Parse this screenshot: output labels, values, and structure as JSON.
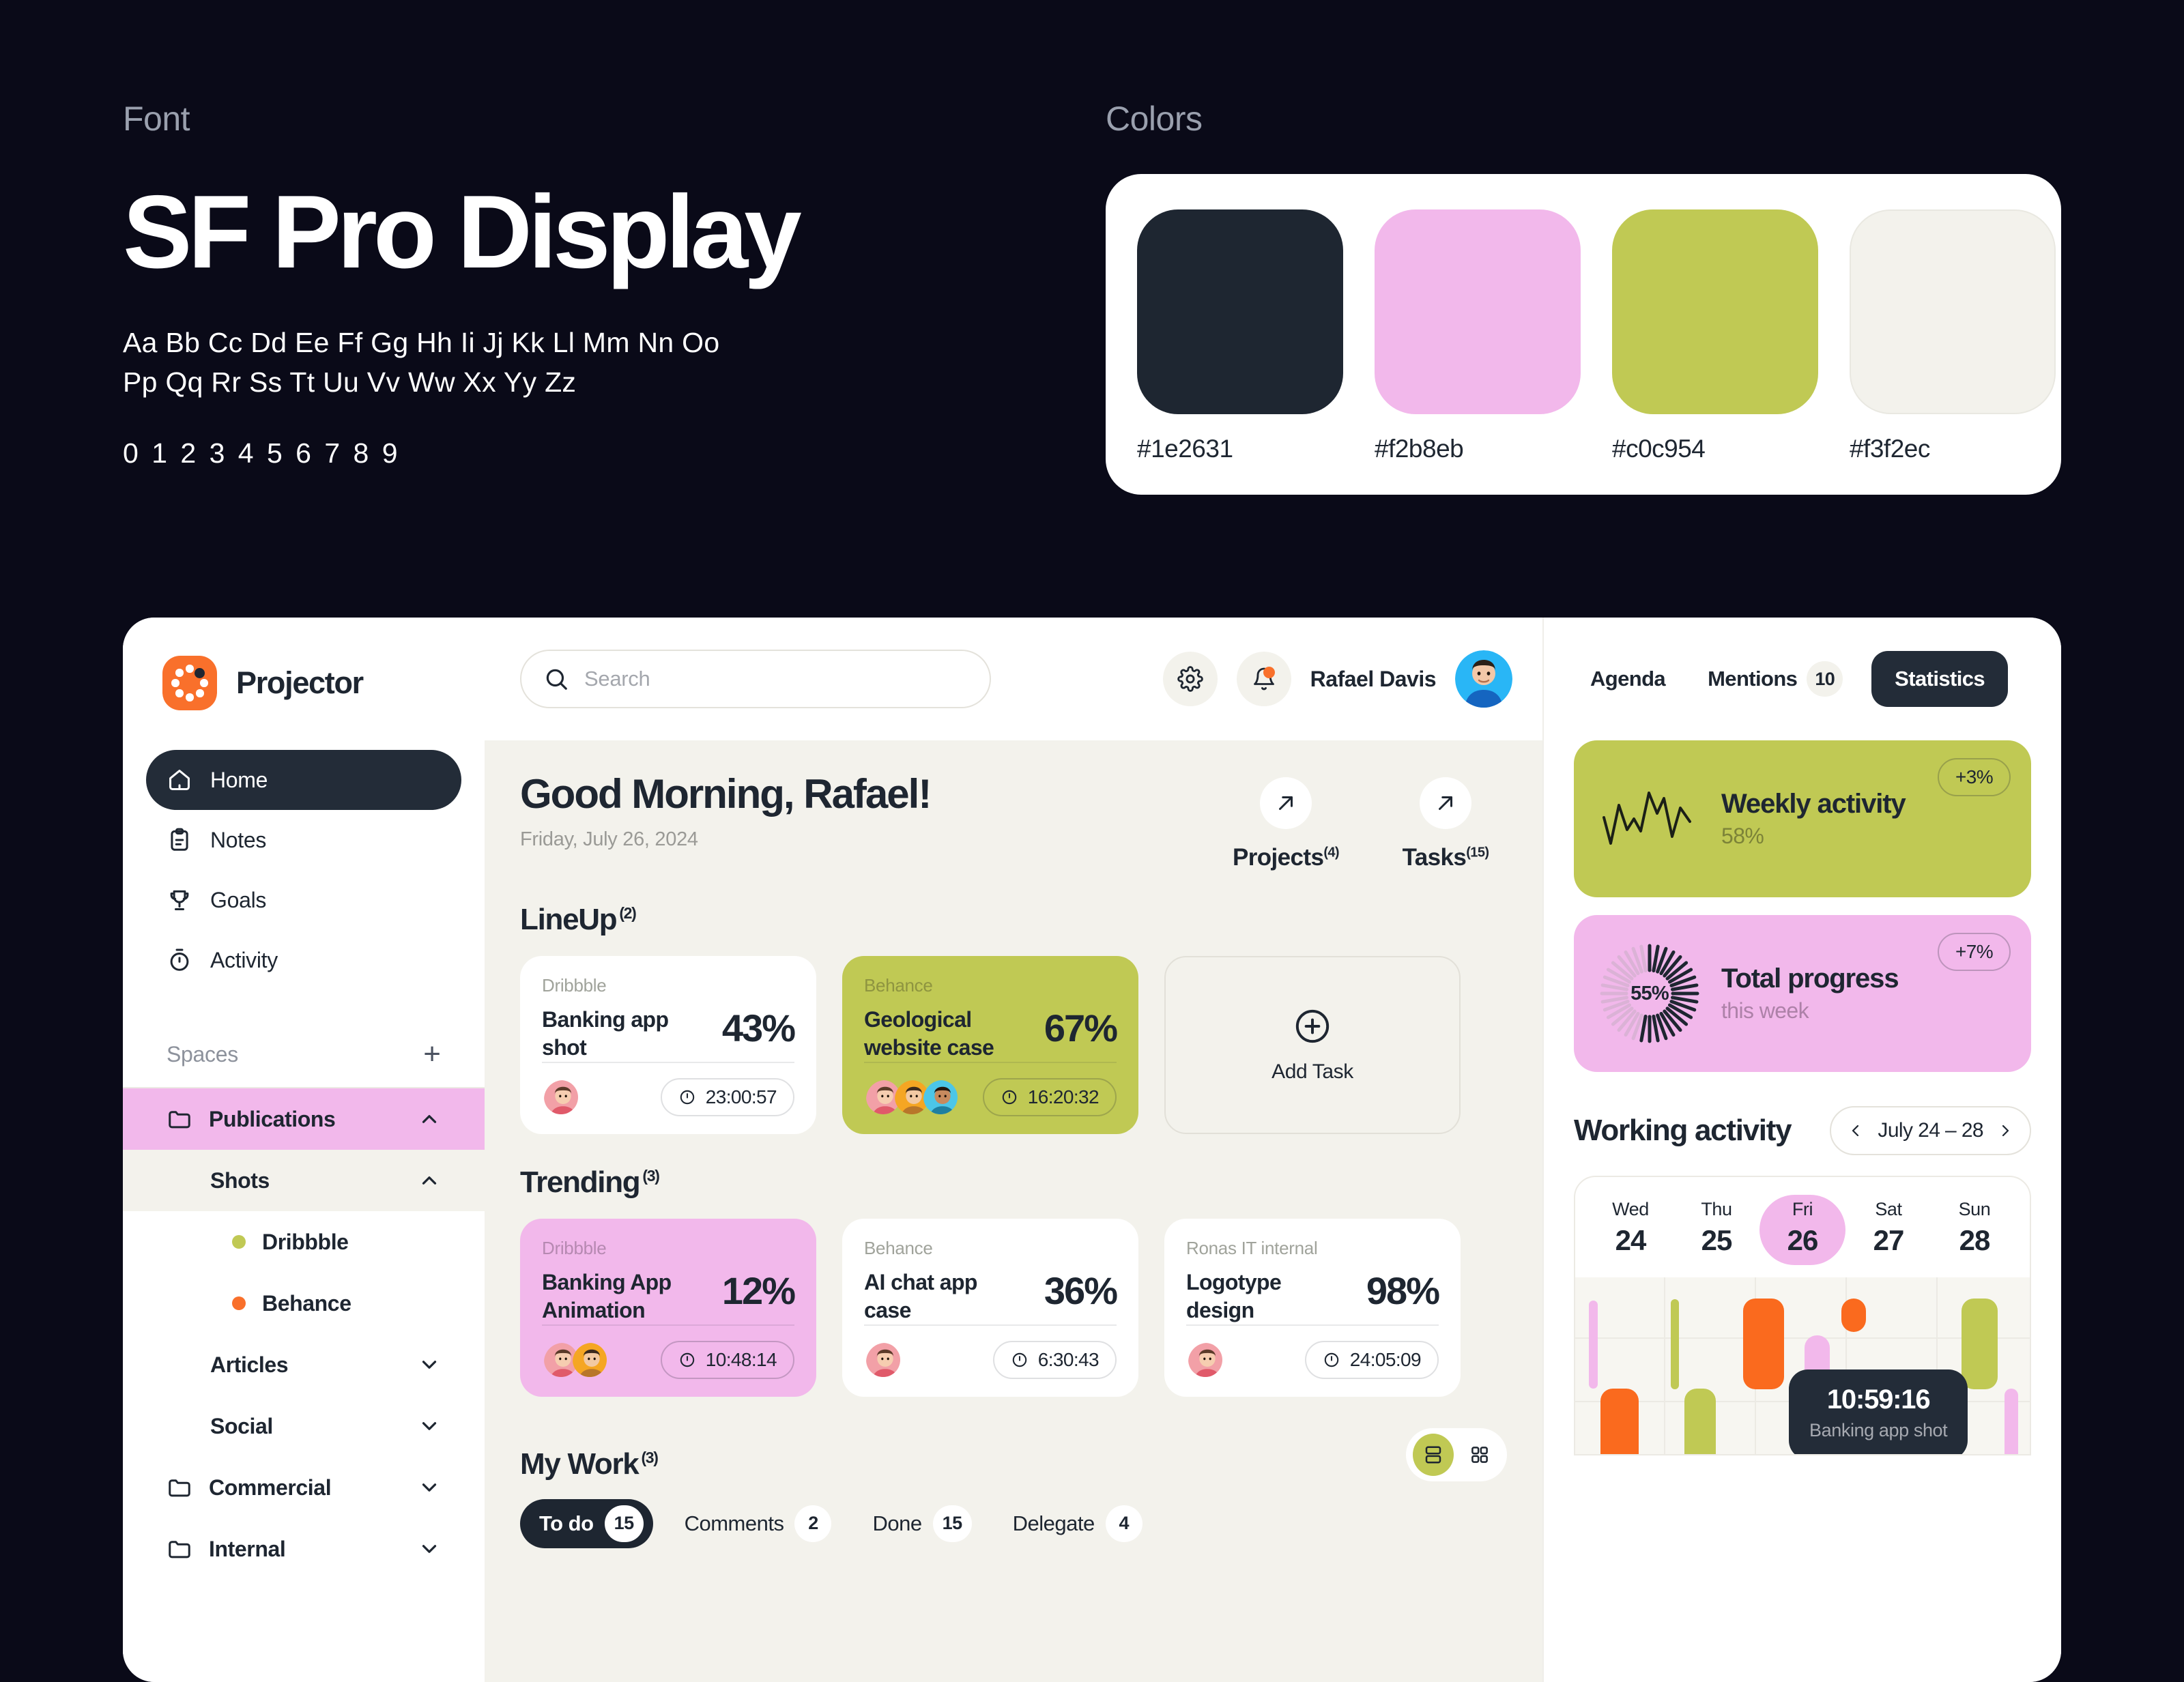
{
  "spec": {
    "font_label": "Font",
    "font_name": "SF Pro Display",
    "alphabet_row1": "Aa Bb Cc Dd Ee Ff Gg Hh Ii Jj Kk Ll Mm Nn Oo",
    "alphabet_row2": "Pp Qq Rr Ss Tt Uu Vv Ww Xx Yy Zz",
    "digits": "0 1 2 3 4 5 6 7 8 9",
    "colors_label": "Colors",
    "swatches": [
      {
        "hex": "#1e2631"
      },
      {
        "hex": "#f2b8eb"
      },
      {
        "hex": "#c0c954"
      },
      {
        "hex": "#f3f2ec"
      }
    ]
  },
  "sidebar": {
    "brand": "Projector",
    "nav": [
      {
        "label": "Home",
        "icon": "home-icon",
        "active": true
      },
      {
        "label": "Notes",
        "icon": "notes-icon",
        "active": false
      },
      {
        "label": "Goals",
        "icon": "trophy-icon",
        "active": false
      },
      {
        "label": "Activity",
        "icon": "stopwatch-icon",
        "active": false
      }
    ],
    "spaces_title": "Spaces",
    "add_space": "+",
    "spaces": [
      {
        "label": "Publications",
        "level": 1,
        "icon": "folder-icon",
        "chevron": "up",
        "hl": "pink",
        "dot": null
      },
      {
        "label": "Shots",
        "level": 2,
        "icon": null,
        "chevron": "up",
        "hl": "cream",
        "dot": null
      },
      {
        "label": "Dribbble",
        "level": 3,
        "icon": null,
        "chevron": null,
        "hl": null,
        "dot": "#c0c954"
      },
      {
        "label": "Behance",
        "level": 3,
        "icon": null,
        "chevron": null,
        "hl": null,
        "dot": "#f9702b"
      },
      {
        "label": "Articles",
        "level": 2,
        "icon": null,
        "chevron": "down",
        "hl": null,
        "dot": null
      },
      {
        "label": "Social",
        "level": 2,
        "icon": null,
        "chevron": "down",
        "hl": null,
        "dot": null
      },
      {
        "label": "Commercial",
        "level": 1,
        "icon": "folder-icon",
        "chevron": "down",
        "hl": null,
        "dot": null
      },
      {
        "label": "Internal",
        "level": 1,
        "icon": "folder-icon",
        "chevron": "down",
        "hl": null,
        "dot": null
      }
    ]
  },
  "topbar": {
    "search_placeholder": "Search",
    "settings_icon": "gear-icon",
    "notifications_icon": "bell-icon",
    "user_name": "Rafael Davis"
  },
  "main": {
    "greeting": "Good Morning, Rafael!",
    "date": "Friday, July 26, 2024",
    "quick_links": [
      {
        "label": "Projects",
        "count": "(4)"
      },
      {
        "label": "Tasks",
        "count": "(15)"
      }
    ],
    "lineup": {
      "title": "LineUp",
      "count": "(2)",
      "cards": [
        {
          "source": "Dribbble",
          "name": "Banking app shot",
          "percent": "43%",
          "timer": "23:00:57",
          "theme": "white",
          "avatars": 1
        },
        {
          "source": "Behance",
          "name": "Geological website case",
          "percent": "67%",
          "timer": "16:20:32",
          "theme": "green",
          "avatars": 3
        }
      ],
      "add_task_label": "Add Task"
    },
    "trending": {
      "title": "Trending",
      "count": "(3)",
      "cards": [
        {
          "source": "Dribbble",
          "name": "Banking App Animation",
          "percent": "12%",
          "timer": "10:48:14",
          "theme": "pink",
          "avatars": 2
        },
        {
          "source": "Behance",
          "name": "AI chat app case",
          "percent": "36%",
          "timer": "6:30:43",
          "theme": "white",
          "avatars": 1
        },
        {
          "source": "Ronas IT internal",
          "name": "Logotype design",
          "percent": "98%",
          "timer": "24:05:09",
          "theme": "white",
          "avatars": 1
        }
      ]
    },
    "my_work": {
      "title": "My Work",
      "count": "(3)",
      "tabs": [
        {
          "label": "To do",
          "count": "15",
          "active": true
        },
        {
          "label": "Comments",
          "count": "2",
          "active": false
        },
        {
          "label": "Done",
          "count": "15",
          "active": false
        },
        {
          "label": "Delegate",
          "count": "4",
          "active": false
        }
      ],
      "view_list_icon": "list-view-icon",
      "view_grid_icon": "grid-view-icon"
    }
  },
  "right": {
    "tabs": [
      {
        "label": "Agenda",
        "count": null,
        "active": false
      },
      {
        "label": "Mentions",
        "count": "10",
        "active": false
      },
      {
        "label": "Statistics",
        "count": null,
        "active": true
      }
    ],
    "stats": [
      {
        "title": "Weekly activity",
        "sub": "58%",
        "badge": "+3%",
        "theme": "green",
        "viz": "sparkline"
      },
      {
        "title": "Total progress",
        "sub": "this week",
        "badge": "+7%",
        "theme": "pink",
        "viz": "radial",
        "radial_label": "55%"
      }
    ],
    "working_activity": {
      "title": "Working activity",
      "range": "July 24 – 28",
      "prev_icon": "chevron-left-icon",
      "next_icon": "chevron-right-icon",
      "days": [
        {
          "name": "Wed",
          "num": "24",
          "selected": false
        },
        {
          "name": "Thu",
          "num": "25",
          "selected": false
        },
        {
          "name": "Fri",
          "num": "26",
          "selected": true
        },
        {
          "name": "Sat",
          "num": "27",
          "selected": false
        },
        {
          "name": "Sun",
          "num": "28",
          "selected": false
        }
      ],
      "tooltip": {
        "time": "10:59:16",
        "task": "Banking app shot"
      }
    }
  },
  "chart_data": {
    "type": "bar",
    "title": "Working activity",
    "categories": [
      "Wed 24",
      "Thu 25",
      "Fri 26",
      "Sat 27",
      "Sun 28"
    ],
    "grid": true,
    "colors": {
      "pink": "#f2b8eb",
      "green": "#c0c954",
      "orange": "#fa6a1e"
    },
    "bars": [
      {
        "day": "Wed 24",
        "color": "#f2b8eb",
        "left": 3.0,
        "top": 13.0,
        "height": 50.0,
        "width": 2.0
      },
      {
        "day": "Wed 24",
        "color": "#fa6a1e",
        "left": 5.5,
        "top": 63.0,
        "height": 46.0,
        "width": 8.5
      },
      {
        "day": "Thu 25",
        "color": "#c0c954",
        "left": 21.0,
        "top": 12.5,
        "height": 51.0,
        "width": 1.8
      },
      {
        "day": "Thu 25",
        "color": "#c0c954",
        "left": 24.0,
        "top": 63.0,
        "height": 46.0,
        "width": 7.0
      },
      {
        "day": "Fri 26",
        "color": "#fa6a1e",
        "left": 37.0,
        "top": 12.0,
        "height": 51.5,
        "width": 9.0
      },
      {
        "day": "Fri 26",
        "color": "#f2b8eb",
        "left": 50.5,
        "top": 33.0,
        "height": 31.0,
        "width": 5.5
      },
      {
        "day": "Fri 26",
        "color": "#fa6a1e",
        "left": 58.5,
        "top": 12.0,
        "height": 19.0,
        "width": 5.5
      },
      {
        "day": "Sat 27",
        "color": "#c0c954",
        "left": 85.0,
        "top": 12.0,
        "height": 51.5,
        "width": 8.0
      },
      {
        "day": "Sat 27",
        "color": "#f2b8eb",
        "left": 94.5,
        "top": 63.0,
        "height": 46.0,
        "width": 3.0
      },
      {
        "day": "Sun 28",
        "color": "#f2b8eb",
        "left": 110.0,
        "top": 12.0,
        "height": 51.5,
        "width": 8.0
      },
      {
        "day": "Sun 28",
        "color": "#c0c954",
        "left": 105.0,
        "top": 63.0,
        "height": 46.0,
        "width": 8.0
      }
    ]
  }
}
